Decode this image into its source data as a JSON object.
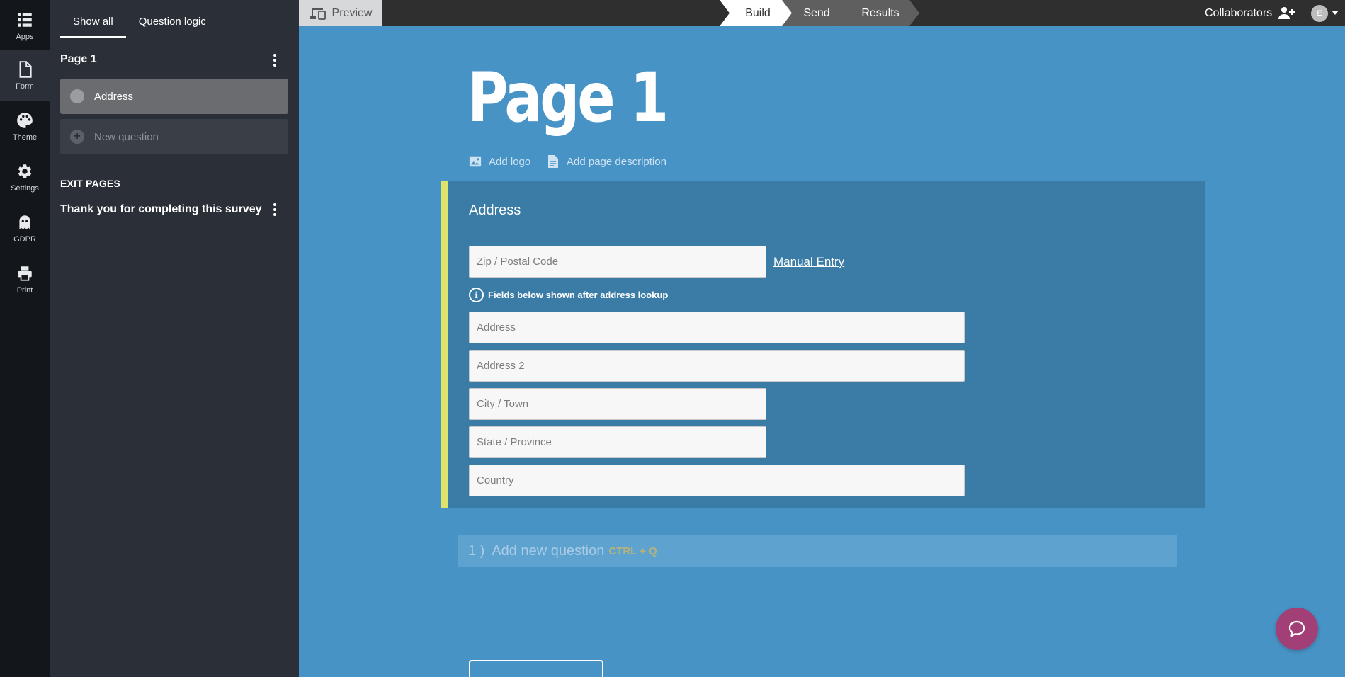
{
  "rail": {
    "items": [
      {
        "label": "Apps",
        "icon": "apps-grid-icon"
      },
      {
        "label": "Form",
        "icon": "document-icon"
      },
      {
        "label": "Theme",
        "icon": "palette-icon"
      },
      {
        "label": "Settings",
        "icon": "gear-icon"
      },
      {
        "label": "GDPR",
        "icon": "ghost-icon"
      },
      {
        "label": "Print",
        "icon": "printer-icon"
      }
    ]
  },
  "sidebar": {
    "tabs": [
      {
        "label": "Show all"
      },
      {
        "label": "Question logic"
      }
    ],
    "page_title": "Page 1",
    "selected_question": "Address",
    "new_question_label": "New question",
    "exit_pages_heading": "EXIT PAGES",
    "exit_page_title": "Thank you for completing this survey"
  },
  "topbar": {
    "preview_label": "Preview",
    "steps": [
      {
        "label": "Build"
      },
      {
        "label": "Send"
      },
      {
        "label": "Results"
      }
    ],
    "collaborators_label": "Collaborators",
    "avatar_initial": "E"
  },
  "main": {
    "page_heading": "Page 1",
    "add_logo_label": "Add logo",
    "add_description_label": "Add page description",
    "question": {
      "title": "Address",
      "zip_placeholder": "Zip / Postal Code",
      "manual_entry_label": "Manual Entry",
      "hint": "Fields below shown after address lookup",
      "address_placeholder": "Address",
      "address2_placeholder": "Address 2",
      "city_placeholder": "City / Town",
      "state_placeholder": "State / Province",
      "country_placeholder": "Country"
    },
    "add_new_question": {
      "number": "1 )",
      "label": "Add new question",
      "shortcut": "CTRL + Q"
    }
  },
  "colors": {
    "canvas": "#4793c6",
    "card": "#3a7ca6",
    "card_accent": "#dfe36b",
    "chat": "#a23f77"
  }
}
